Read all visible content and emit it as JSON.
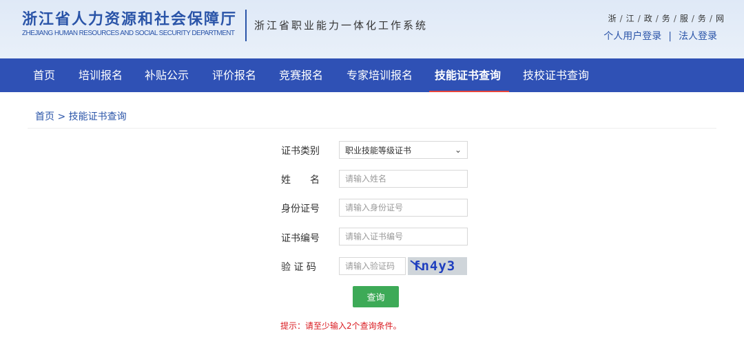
{
  "header": {
    "org_name_cn": "浙江省人力资源和社会保障厅",
    "org_name_en": "ZHEJIANG HUMAN RESOURCES AND SOCIAL SECURITY DEPARTMENT",
    "system_title": "浙江省职业能力一体化工作系统",
    "portal": [
      "浙",
      "江",
      "政",
      "务",
      "服",
      "务",
      "网"
    ],
    "login": {
      "personal": "个人用户登录",
      "separator": "|",
      "legal": "法人登录"
    }
  },
  "nav": {
    "items": [
      {
        "label": "首页"
      },
      {
        "label": "培训报名"
      },
      {
        "label": "补贴公示"
      },
      {
        "label": "评价报名"
      },
      {
        "label": "竞赛报名"
      },
      {
        "label": "专家培训报名"
      },
      {
        "label": "技能证书查询"
      },
      {
        "label": "技校证书查询"
      }
    ],
    "active_label": "技能证书查询",
    "background": "#2f51b5",
    "active_underline": "#e8453c"
  },
  "breadcrumb": {
    "home": "首页",
    "separator": ">",
    "current": "技能证书查询"
  },
  "form": {
    "cert_type": {
      "label": "证书类别",
      "value": "职业技能等级证书"
    },
    "name": {
      "label": "姓　　名",
      "placeholder": "请输入姓名"
    },
    "id_number": {
      "label": "身份证号",
      "placeholder": "请输入身份证号"
    },
    "cert_number": {
      "label": "证书编号",
      "placeholder": "请输入证书编号"
    },
    "captcha": {
      "label": "验 证 码",
      "placeholder": "请输入验证码",
      "image_text": "fn4y3"
    },
    "submit_label": "查询",
    "submit_color": "#3daa57",
    "tip": "提示：请至少输入2个查询条件。",
    "tip_color": "#d9191f"
  }
}
